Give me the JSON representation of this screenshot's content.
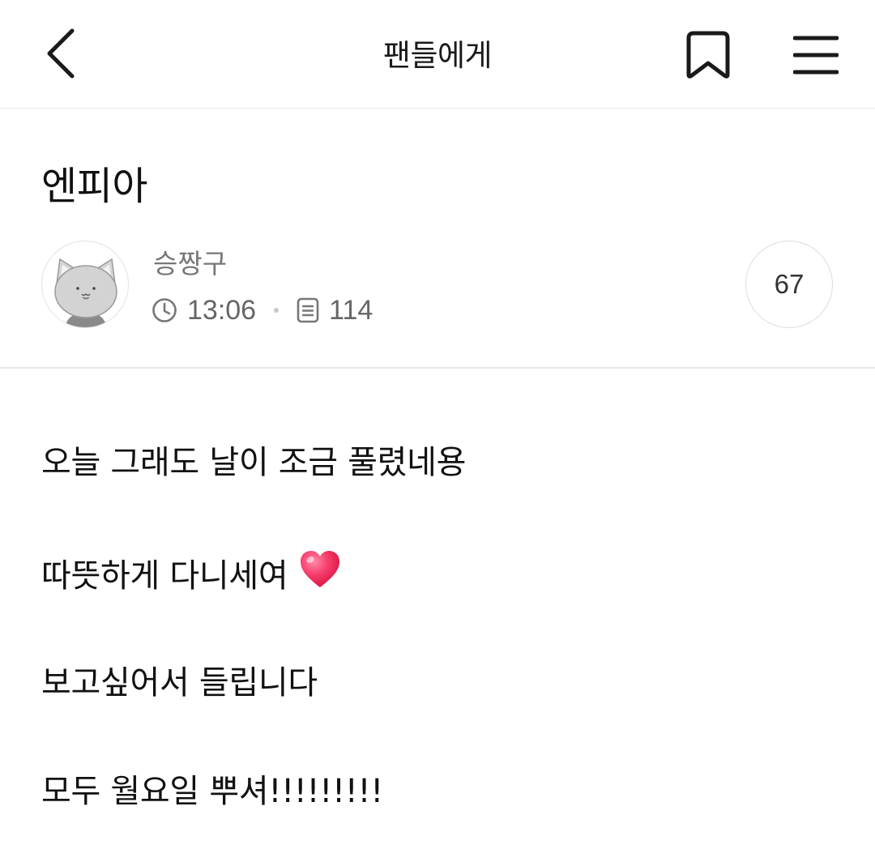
{
  "header": {
    "title": "팬들에게",
    "back_icon": "chevron-left-icon",
    "bookmark_icon": "bookmark-icon",
    "menu_icon": "hamburger-menu-icon"
  },
  "post": {
    "title": "엔피아",
    "author": {
      "name": "승짱구",
      "avatar_icon": "cat-avatar-icon"
    },
    "time": "13:06",
    "views": "114",
    "comment_count": "67",
    "body": {
      "line1": "오늘 그래도 날이 조금 풀렸네용",
      "line2": "따뜻하게 다니세여",
      "line2_emoji": "heart-emoji",
      "line3": "보고싶어서 들립니다",
      "line4": "모두 월요일 뿌셔!!!!!!!!!"
    }
  },
  "colors": {
    "text_primary": "#111111",
    "text_secondary": "#777777",
    "divider": "#e6e6e6",
    "heart": "#f4295a"
  }
}
